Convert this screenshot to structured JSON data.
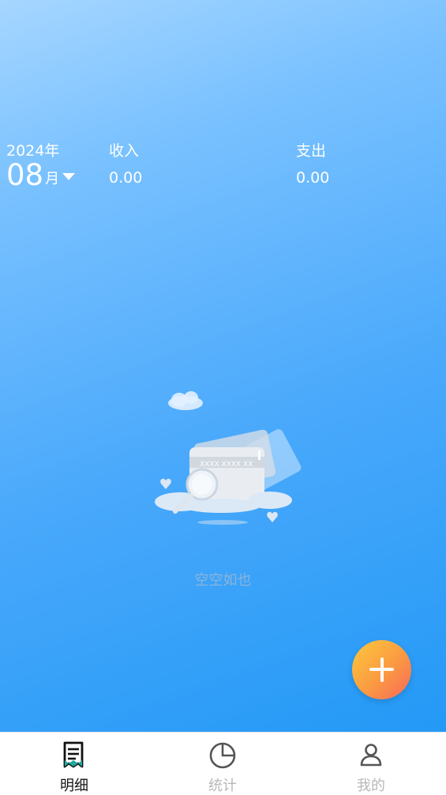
{
  "header": {
    "year": "2024年",
    "month": "08",
    "month_suffix": "月",
    "income_label": "收入",
    "income_value": "0.00",
    "expense_label": "支出",
    "expense_value": "0.00"
  },
  "empty_state": {
    "card_number": "XXXX XXXX XX",
    "message": "空空如也"
  },
  "tabs": [
    {
      "label": "明细",
      "icon": "receipt-icon",
      "active": true
    },
    {
      "label": "统计",
      "icon": "pie-chart-icon",
      "active": false
    },
    {
      "label": "我的",
      "icon": "user-icon",
      "active": false
    }
  ],
  "colors": {
    "tab_active": "#111111",
    "tab_inactive": "#b8b8b8",
    "accent_teal": "#1fa89b",
    "fab_start": "#fcc93b",
    "fab_end": "#f7665a"
  }
}
